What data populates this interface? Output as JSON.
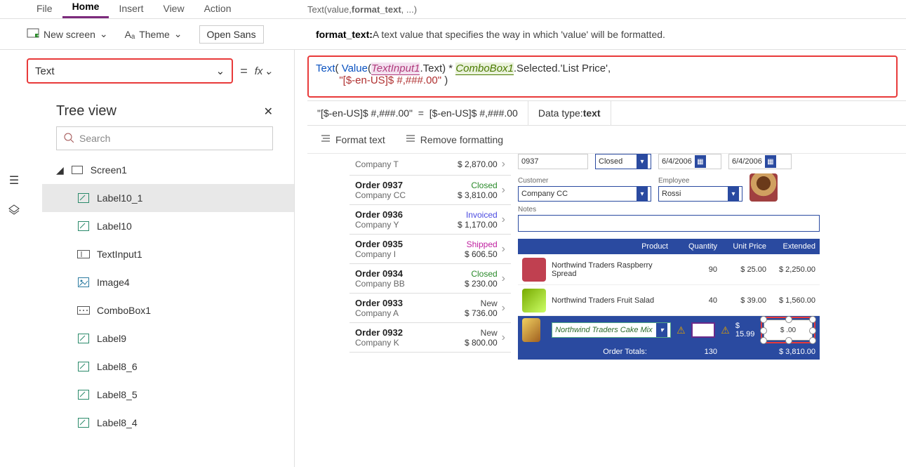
{
  "menu": {
    "file": "File",
    "home": "Home",
    "insert": "Insert",
    "view": "View",
    "action": "Action"
  },
  "signature": {
    "prefix": "Text(value, ",
    "bold": "format_text",
    "suffix": ", ...)"
  },
  "toolbar": {
    "new_screen": "New screen",
    "theme": "Theme",
    "font": "Open Sans"
  },
  "property_selector": "Text",
  "hint": {
    "label": "format_text:",
    "text": " A text value that specifies the way in which 'value' will be formatted."
  },
  "formula": {
    "fn": "Text",
    "valfn": "Value",
    "ref1": "TextInput1",
    "ref1_suffix": ".Text",
    "op": " * ",
    "ref2": "ComboBox1",
    "ref2_suffix": ".Selected.'List Price'",
    "str": "\"[$-en-US]$ #,###.00\""
  },
  "result": {
    "lhs": "\"[$-en-US]$ #,###.00\"",
    "rhs": "[$-en-US]$ #,###.00",
    "datatype_label": "Data type: ",
    "datatype": "text"
  },
  "actions": {
    "format": "Format text",
    "remove": "Remove formatting"
  },
  "tree": {
    "title": "Tree view",
    "search_placeholder": "Search",
    "root": "Screen1",
    "items": [
      {
        "icon": "label",
        "name": "Label10_1",
        "selected": true
      },
      {
        "icon": "label",
        "name": "Label10"
      },
      {
        "icon": "textinput",
        "name": "TextInput1"
      },
      {
        "icon": "image",
        "name": "Image4"
      },
      {
        "icon": "combo",
        "name": "ComboBox1"
      },
      {
        "icon": "label",
        "name": "Label9"
      },
      {
        "icon": "label",
        "name": "Label8_6"
      },
      {
        "icon": "label",
        "name": "Label8_5"
      },
      {
        "icon": "label",
        "name": "Label8_4"
      }
    ]
  },
  "orders": [
    {
      "title": "",
      "sub": "Company T",
      "status": "",
      "price": "$ 2,870.00"
    },
    {
      "title": "Order 0937",
      "sub": "Company CC",
      "status": "Closed",
      "cls": "closed",
      "price": "$ 3,810.00"
    },
    {
      "title": "Order 0936",
      "sub": "Company Y",
      "status": "Invoiced",
      "cls": "invoiced",
      "price": "$ 1,170.00"
    },
    {
      "title": "Order 0935",
      "sub": "Company I",
      "status": "Shipped",
      "cls": "shipped",
      "price": "$ 606.50"
    },
    {
      "title": "Order 0934",
      "sub": "Company BB",
      "status": "Closed",
      "cls": "closed",
      "price": "$ 230.00"
    },
    {
      "title": "Order 0933",
      "sub": "Company A",
      "status": "New",
      "cls": "new",
      "price": "$ 736.00"
    },
    {
      "title": "Order 0932",
      "sub": "Company K",
      "status": "New",
      "cls": "new",
      "price": "$ 800.00"
    }
  ],
  "detail": {
    "order_no": "0937",
    "status": "Closed",
    "date1": "6/4/2006",
    "date2": "6/4/2006",
    "customer_label": "Customer",
    "customer": "Company CC",
    "employee_label": "Employee",
    "employee": "Rossi",
    "notes_label": "Notes",
    "headers": {
      "product": "Product",
      "qty": "Quantity",
      "unit": "Unit Price",
      "ext": "Extended"
    },
    "lines": [
      {
        "name": "Northwind Traders Raspberry Spread",
        "qty": "90",
        "unit": "$ 25.00",
        "ext": "$ 2,250.00",
        "img": "r"
      },
      {
        "name": "Northwind Traders Fruit Salad",
        "qty": "40",
        "unit": "$ 39.00",
        "ext": "$ 1,560.00",
        "img": "g"
      }
    ],
    "edit": {
      "product": "Northwind Traders Cake Mix",
      "unit": "$ 15.99",
      "ext": "$ .00"
    },
    "totals": {
      "label": "Order Totals:",
      "qty": "130",
      "ext": "$ 3,810.00"
    }
  }
}
